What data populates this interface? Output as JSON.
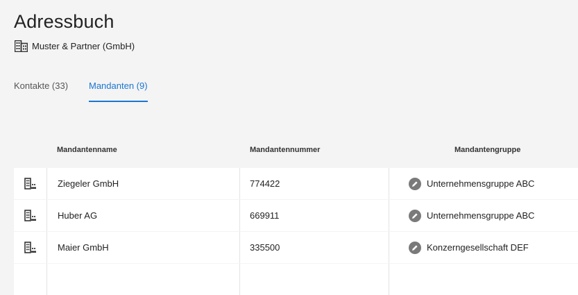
{
  "header": {
    "title": "Adressbuch",
    "organization": "Muster & Partner (GmbH)",
    "organization_icon": "building-icon"
  },
  "tabs": [
    {
      "label": "Kontakte (33)",
      "active": false
    },
    {
      "label": "Mandanten (9)",
      "active": true
    }
  ],
  "table": {
    "columns": [
      "Mandantenname",
      "Mandantennummer",
      "Mandantengruppe"
    ],
    "rows": [
      {
        "icon": "client-building-icon",
        "name": "Ziegeler GmbH",
        "number": "774422",
        "group_icon": "edit-icon",
        "group": "Unternehmensgruppe ABC"
      },
      {
        "icon": "client-building-icon",
        "name": "Huber AG",
        "number": "669911",
        "group_icon": "edit-icon",
        "group": "Unternehmensgruppe ABC"
      },
      {
        "icon": "client-building-icon",
        "name": "Maier GmbH",
        "number": "335500",
        "group_icon": "edit-icon",
        "group": "Konzerngesellschaft DEF"
      },
      {
        "icon": "client-building-icon",
        "name": "",
        "number": "",
        "group_icon": "",
        "group": ""
      }
    ]
  },
  "colors": {
    "accent": "#1976d2",
    "background": "#f4f4f4",
    "row_background": "#ffffff",
    "edit_icon": "#7a7a7a"
  }
}
